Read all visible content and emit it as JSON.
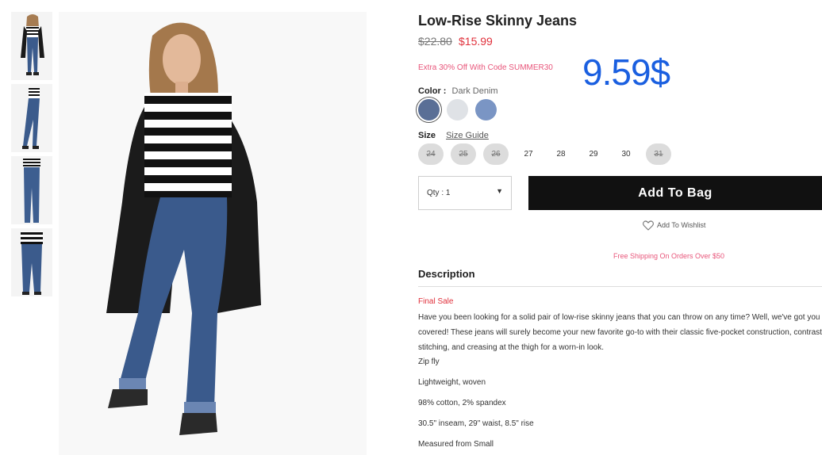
{
  "product": {
    "title": "Low-Rise Skinny Jeans",
    "old_price": "$22.80",
    "new_price": "$15.99",
    "promo": "Extra 30% Off With Code SUMMER30",
    "overlay_price": "9.59$"
  },
  "color": {
    "label": "Color :",
    "value": "Dark Denim",
    "swatches": [
      {
        "name": "Dark Denim",
        "color": "#5a6f96"
      },
      {
        "name": "Light",
        "color": "#dfe2e6"
      },
      {
        "name": "Medium Denim",
        "color": "#7a95c4"
      }
    ]
  },
  "size": {
    "label": "Size",
    "guide": "Size Guide",
    "options": [
      {
        "label": "24",
        "available": false
      },
      {
        "label": "25",
        "available": false
      },
      {
        "label": "26",
        "available": false
      },
      {
        "label": "27",
        "available": true
      },
      {
        "label": "28",
        "available": true
      },
      {
        "label": "29",
        "available": true
      },
      {
        "label": "30",
        "available": true
      },
      {
        "label": "31",
        "available": false
      }
    ]
  },
  "purchase": {
    "qty_label": "Qty : 1",
    "caret": "▼",
    "add_to_bag": "Add To Bag",
    "wishlist": "Add To Wishlist",
    "shipping": "Free Shipping On Orders Over $50"
  },
  "description": {
    "heading": "Description",
    "final_sale": "Final Sale",
    "text": "Have you been looking for a solid pair of low-rise skinny jeans that you can throw on any time? Well, we've got you covered! These jeans will surely become your new favorite go-to with their classic five-pocket construction, contrast stitching, and creasing at the thigh for a worn-in look.",
    "features": [
      "Zip fly",
      "Lightweight, woven",
      "98% cotton, 2% spandex",
      "30.5\" inseam, 29\" waist, 8.5\" rise",
      "Measured from Small"
    ]
  }
}
